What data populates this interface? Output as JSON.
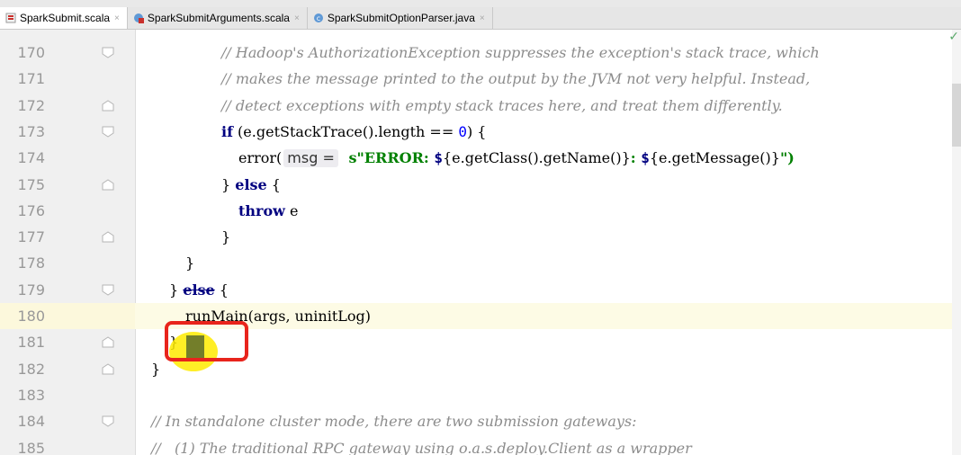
{
  "tabs": [
    {
      "label": "SparkSubmit.scala",
      "active": true,
      "icon": "scala-file-icon"
    },
    {
      "label": "SparkSubmitArguments.scala",
      "active": false,
      "icon": "scala-class-icon"
    },
    {
      "label": "SparkSubmitOptionParser.java",
      "active": false,
      "icon": "java-class-icon"
    }
  ],
  "close_glyph": "×",
  "inspection_ok_glyph": "✓",
  "lines": {
    "170": {
      "num": "170",
      "c": "// Hadoop's AuthorizationException suppresses the exception's stack trace, which"
    },
    "171": {
      "num": "171",
      "c": "// makes the message printed to the output by the JVM not very helpful. Instead,"
    },
    "172": {
      "num": "172",
      "c": "// detect exceptions with empty stack traces here, and treat them differently."
    },
    "173": {
      "num": "173",
      "kw": "if",
      "t1": " (e.",
      "t2": "getStackTrace",
      "t3": "().",
      "t4": "length",
      "t5": " == ",
      "n": "0",
      "t6": ") {"
    },
    "174": {
      "num": "174",
      "t1": "error(",
      "hint": "msg =",
      "s": "s\"ERROR: ",
      "d1": "$",
      "i1": "{e.getClass().getName()}",
      "s2": ": ",
      "d2": "$",
      "i2": "{e.getMessage()}",
      "s3": "\")"
    },
    "175": {
      "num": "175",
      "t1": "} ",
      "kw": "else",
      "t2": " {"
    },
    "176": {
      "num": "176",
      "kw": "throw",
      "t1": " e"
    },
    "177": {
      "num": "177",
      "t1": "}"
    },
    "178": {
      "num": "178",
      "t1": "}"
    },
    "179": {
      "num": "179",
      "t1": "} ",
      "kw": "else",
      "t2": " {"
    },
    "180": {
      "num": "180",
      "t1": "runMain",
      "t2": "(args, uninitLog)"
    },
    "181": {
      "num": "181",
      "t1": "}"
    },
    "182": {
      "num": "182",
      "t1": "}"
    },
    "183": {
      "num": "183"
    },
    "184": {
      "num": "184",
      "c": "// In standalone cluster mode, there are two submission gateways:"
    },
    "185": {
      "num": "185",
      "c": "//   (1) The traditional RPC gateway using o.a.s.deploy.Client as a wrapper"
    }
  }
}
